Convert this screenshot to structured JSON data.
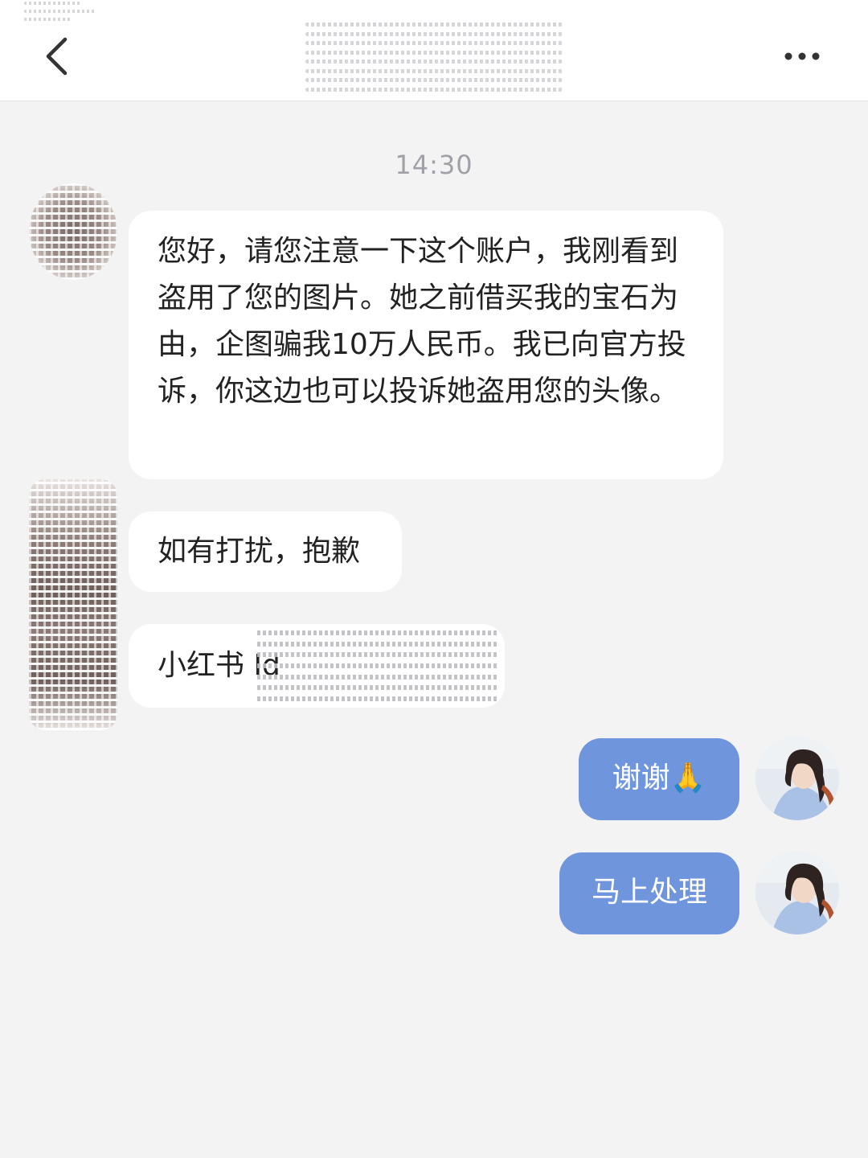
{
  "header": {
    "back_icon": "chevron-left-icon",
    "more_icon": "more-dots-icon"
  },
  "conversation": {
    "timestamp": "14:30",
    "received": [
      {
        "text": "您好，请您注意一下这个账户，我刚看到盗用了您的图片。她之前借买我的宝石为由，企图骗我10万人民币。我已向官方投诉，你这边也可以投诉她盗用您的头像。"
      },
      {
        "text": "如有打扰，抱歉"
      },
      {
        "text": "小红书 Id"
      }
    ],
    "sent": [
      {
        "text": "谢谢🙏"
      },
      {
        "text": "马上处理"
      }
    ]
  },
  "colors": {
    "sent_bubble": "#6f95dd",
    "received_bubble": "#ffffff",
    "background": "#f3f3f4"
  }
}
